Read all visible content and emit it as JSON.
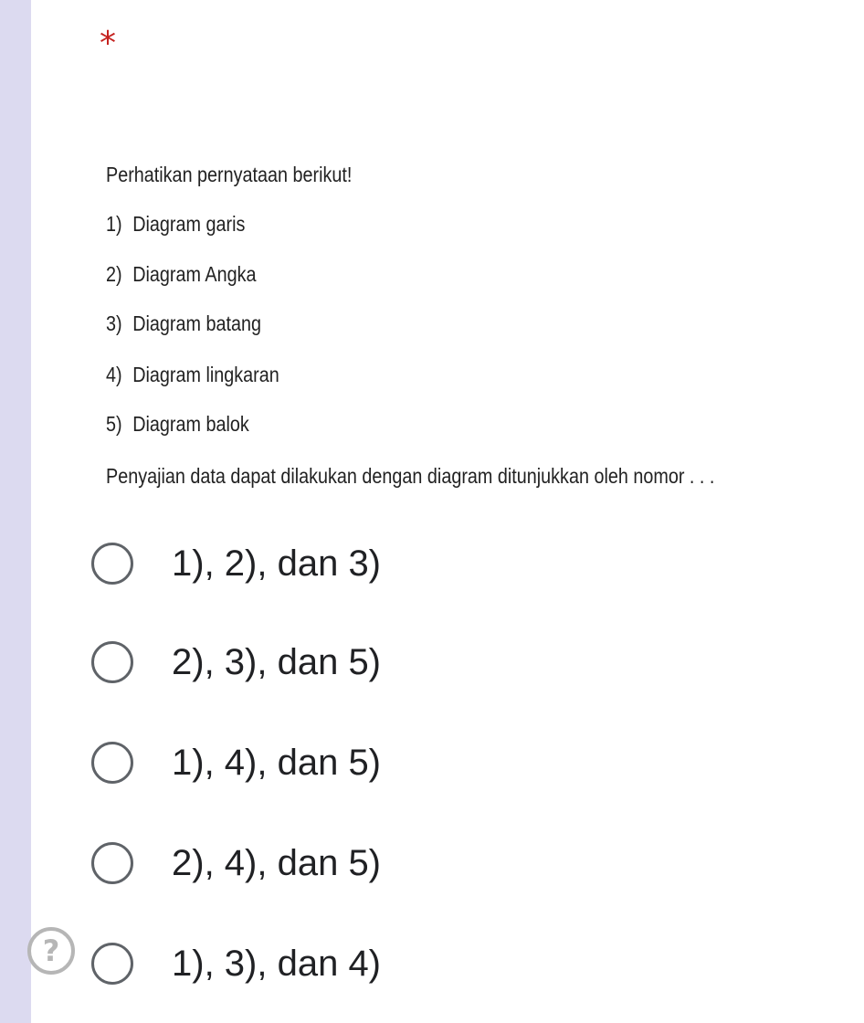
{
  "question": {
    "required_marker": "*",
    "intro": "Perhatikan pernyataan berikut!",
    "items": [
      {
        "num": "1)",
        "text": "Diagram garis"
      },
      {
        "num": "2)",
        "text": "Diagram Angka"
      },
      {
        "num": "3)",
        "text": "Diagram batang"
      },
      {
        "num": "4)",
        "text": "Diagram lingkaran"
      },
      {
        "num": "5)",
        "text": "Diagram balok"
      }
    ],
    "prompt": "Penyajian data dapat dilakukan dengan diagram ditunjukkan oleh nomor . . ."
  },
  "options": [
    {
      "label": "1), 2), dan 3)",
      "selected": false
    },
    {
      "label": "2), 3), dan 5)",
      "selected": false
    },
    {
      "label": "1), 4), dan 5)",
      "selected": false
    },
    {
      "label": "2), 4), dan 5)",
      "selected": false
    },
    {
      "label": "1), 3), dan 4)",
      "selected": false
    }
  ],
  "help": {
    "icon": "question-mark-icon",
    "glyph": "?"
  },
  "colors": {
    "left_rail": "#dcdaf0",
    "required": "#c5221f",
    "radio_border": "#5f6368",
    "help_icon": "#b6b6b6"
  }
}
